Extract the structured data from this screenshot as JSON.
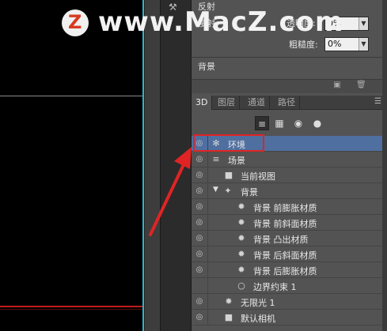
{
  "watermark": {
    "logo_letter": "Z",
    "text": "www.MacZ.com"
  },
  "properties": {
    "reflection_label": "反射",
    "row2_label": "漫射",
    "transparency_label": "透明度:",
    "transparency_value": "0%",
    "roughness_label": "粗糙度:",
    "roughness_value": "0%",
    "background_label": "背景"
  },
  "tabs": [
    {
      "label": "3D",
      "active": true
    },
    {
      "label": "图层",
      "active": false
    },
    {
      "label": "通道",
      "active": false
    },
    {
      "label": "路径",
      "active": false
    }
  ],
  "filter_icons": [
    "scene-filter-icon",
    "mesh-filter-icon",
    "material-filter-icon",
    "light-filter-icon"
  ],
  "scene_tree": [
    {
      "label": "环境",
      "icon": "environment-icon",
      "selected": true
    },
    {
      "label": "场景",
      "icon": "scene-icon",
      "selected": false
    },
    {
      "label": "当前视图",
      "icon": "camera-icon",
      "selected": false
    },
    {
      "label": "背景",
      "icon": "mesh-icon",
      "selected": false,
      "expanded": true
    },
    {
      "label": "背景 前膨胀材质",
      "icon": "material-icon",
      "selected": false
    },
    {
      "label": "背景 前斜面材质",
      "icon": "material-icon",
      "selected": false
    },
    {
      "label": "背景 凸出材质",
      "icon": "material-icon",
      "selected": false
    },
    {
      "label": "背景 后斜面材质",
      "icon": "material-icon",
      "selected": false
    },
    {
      "label": "背景 后膨胀材质",
      "icon": "material-icon",
      "selected": false
    },
    {
      "label": "边界约束 1",
      "icon": "constraint-icon",
      "selected": false
    },
    {
      "label": "无限光 1",
      "icon": "light-icon",
      "selected": false
    },
    {
      "label": "默认相机",
      "icon": "camera-icon",
      "selected": false
    }
  ],
  "colors": {
    "highlight": "#e02424",
    "selection": "#4f6fa0",
    "guide": "#2bb6c8"
  }
}
